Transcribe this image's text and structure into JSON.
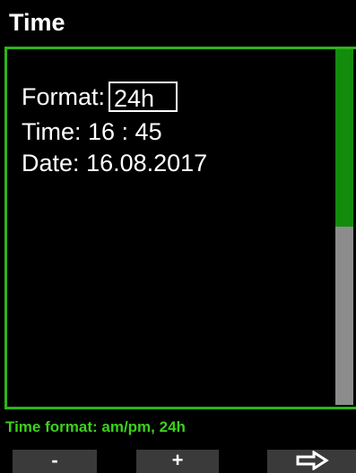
{
  "header": {
    "title": "Time"
  },
  "settings": {
    "format_label": "Format:",
    "format_value": "24h",
    "time_label": "Time:",
    "time_value": "16 : 45",
    "date_label": "Date:",
    "date_value": "16.08.2017"
  },
  "scrollbar": {
    "position_fraction": 0.5
  },
  "help": {
    "text": "Time format: am/pm, 24h"
  },
  "softkeys": {
    "left_label": "-",
    "middle_label": "+",
    "right_icon": "arrow-right-icon"
  },
  "colors": {
    "accent": "#2db51a",
    "help_text": "#3cd11b",
    "scroll_thumb": "#138c0e",
    "scroll_track": "#8c8c8c",
    "softkey_bg": "#3a3a3a"
  }
}
